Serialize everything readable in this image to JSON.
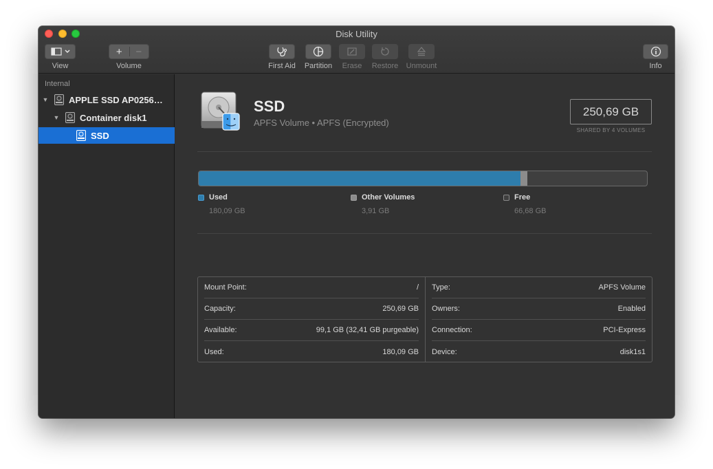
{
  "window": {
    "title": "Disk Utility"
  },
  "toolbar": {
    "view_label": "View",
    "volume_label": "Volume",
    "volume_add": "+",
    "volume_remove": "−",
    "first_aid_label": "First Aid",
    "partition_label": "Partition",
    "erase_label": "Erase",
    "restore_label": "Restore",
    "unmount_label": "Unmount",
    "info_label": "Info"
  },
  "sidebar": {
    "section_header": "Internal",
    "items": [
      {
        "label": "APPLE SSD AP0256…",
        "icon": "internal-disk-icon"
      },
      {
        "label": "Container disk1",
        "icon": "internal-disk-icon"
      },
      {
        "label": "SSD",
        "icon": "volume-icon",
        "selected": true
      }
    ]
  },
  "volume": {
    "name": "SSD",
    "subtitle": "APFS Volume • APFS (Encrypted)",
    "capacity": "250,69 GB",
    "shared_note": "SHARED BY 4 VOLUMES"
  },
  "usage": {
    "used_fraction": 0.7181,
    "other_fraction": 0.0156,
    "colors": {
      "used": "#2e7dac",
      "other": "#8c8c8c",
      "free": "#3f3f3f"
    },
    "legend": [
      {
        "label": "Used",
        "value": "180,09 GB",
        "color": "#2e7dac"
      },
      {
        "label": "Other Volumes",
        "value": "3,91 GB",
        "color": "#8c8c8c"
      },
      {
        "label": "Free",
        "value": "66,68 GB",
        "color": "#3f3f3f"
      }
    ]
  },
  "details": {
    "left": [
      {
        "key": "Mount Point:",
        "value": "/"
      },
      {
        "key": "Capacity:",
        "value": "250,69 GB"
      },
      {
        "key": "Available:",
        "value": "99,1 GB (32,41 GB purgeable)"
      },
      {
        "key": "Used:",
        "value": "180,09 GB"
      }
    ],
    "right": [
      {
        "key": "Type:",
        "value": "APFS Volume"
      },
      {
        "key": "Owners:",
        "value": "Enabled"
      },
      {
        "key": "Connection:",
        "value": "PCI-Express"
      },
      {
        "key": "Device:",
        "value": "disk1s1"
      }
    ]
  }
}
